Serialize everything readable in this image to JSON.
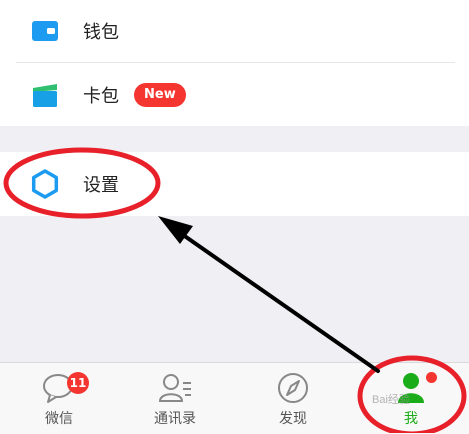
{
  "menu": {
    "wallet_label": "钱包",
    "cards_label": "卡包",
    "cards_badge": "New",
    "settings_label": "设置"
  },
  "tabbar": {
    "chats_label": "微信",
    "chats_unread": "11",
    "contacts_label": "通讯录",
    "discover_label": "发现",
    "me_label": "我"
  },
  "watermark": "Bai经验",
  "colors": {
    "accent_green": "#1aad19",
    "badge_red": "#f43530",
    "annotation_red": "#e8202a",
    "icon_blue": "#1d9bf0"
  },
  "icons": {
    "wallet": "wallet-icon",
    "cards": "card-icon",
    "settings": "gear-icon",
    "chats": "chat-bubble-icon",
    "contacts": "contacts-icon",
    "discover": "compass-icon",
    "me": "person-icon"
  }
}
